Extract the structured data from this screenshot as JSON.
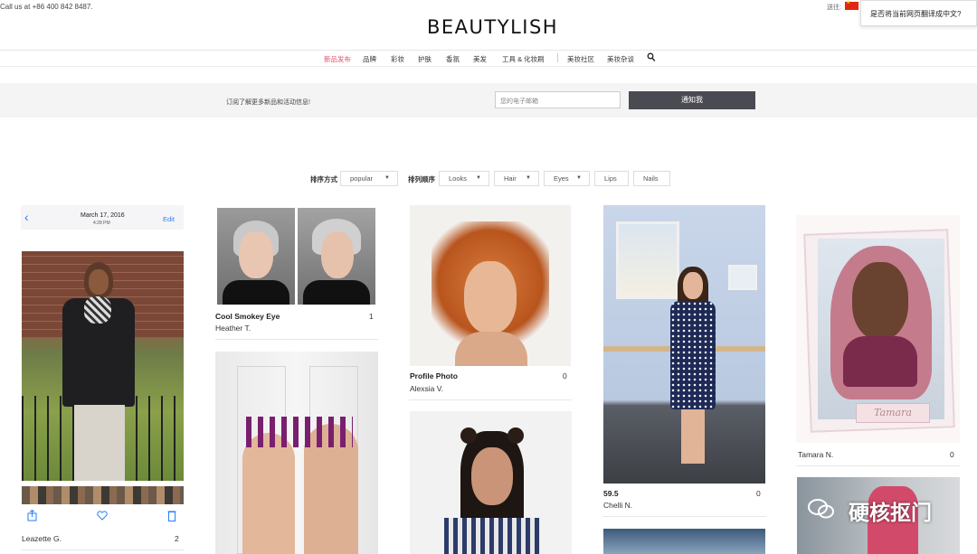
{
  "topbar": {
    "call": "Call us at +86 400 842 8487.",
    "logo": "BEAUTYLISH",
    "ship_to": "送往:",
    "translate_prompt": "是否将当前网页翻译成中文?"
  },
  "nav": {
    "items": [
      "新品发布",
      "品牌",
      "彩妆",
      "护肤",
      "香氛",
      "美发",
      "工具 & 化妆刷",
      "美妆社区",
      "美妆杂谈"
    ],
    "active_index": 0,
    "accent_color": "#e0516a"
  },
  "subscribe": {
    "text": "订阅了解更多新品和活动信息!",
    "email_placeholder": "您的电子邮箱",
    "button": "通知我"
  },
  "filters": {
    "sort_label": "排序方式",
    "sort_value": "popular",
    "order_label": "排列顺序",
    "chips": [
      "Looks",
      "Hair",
      "Eyes",
      "Lips",
      "Nails"
    ]
  },
  "gallery": {
    "phone": {
      "date": "March 17, 2016",
      "time": "4:28 PM",
      "edit": "Edit",
      "author": "Leazette G.",
      "count": "2"
    },
    "cards": [
      {
        "title": "Cool Smokey Eye",
        "author": "Heather T.",
        "count": "1"
      },
      {
        "title": "Profile Photo",
        "author": "Alexsia V.",
        "count": "0"
      },
      {
        "title": "59.5",
        "author": "Chelli N.",
        "count": "0"
      },
      {
        "title": "",
        "author": "Tamara N.",
        "count": "0"
      }
    ],
    "frame_caption": "Tamara"
  },
  "watermark": "硬核抠门"
}
